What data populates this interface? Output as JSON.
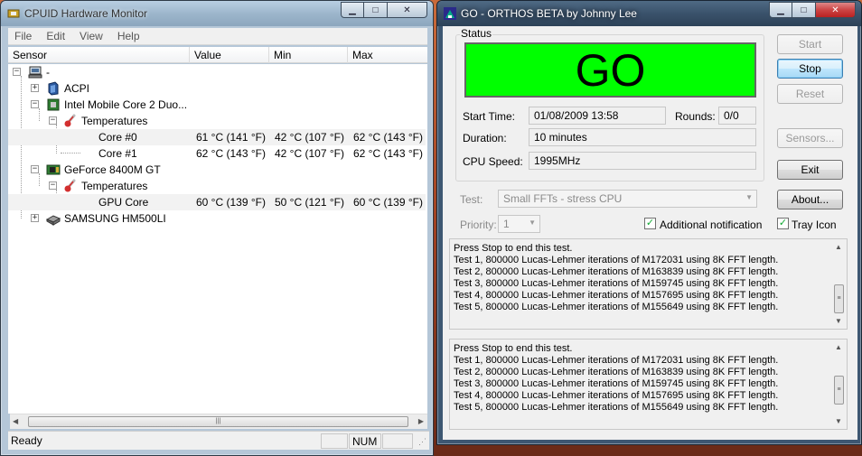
{
  "hwmon": {
    "title": "CPUID Hardware Monitor",
    "menu": [
      "File",
      "Edit",
      "View",
      "Help"
    ],
    "columns": [
      "Sensor",
      "Value",
      "Min",
      "Max"
    ],
    "root_label": "-",
    "tree": {
      "acpi": "ACPI",
      "cpu": "Intel Mobile Core 2 Duo...",
      "cpu_temps": "Temperatures",
      "core0": {
        "name": "Core #0",
        "value": "61 °C  (141 °F)",
        "min": "42 °C  (107 °F)",
        "max": "62 °C  (143 °F)"
      },
      "core1": {
        "name": "Core #1",
        "value": "62 °C  (143 °F)",
        "min": "42 °C  (107 °F)",
        "max": "62 °C  (143 °F)"
      },
      "gpu": "GeForce 8400M GT",
      "gpu_temps": "Temperatures",
      "gpucore": {
        "name": "GPU Core",
        "value": "60 °C  (139 °F)",
        "min": "50 °C  (121 °F)",
        "max": "60 °C  (139 °F)"
      },
      "hdd": "SAMSUNG HM500LI"
    },
    "status": "Ready",
    "num": "NUM"
  },
  "orthos": {
    "title": "GO - ORTHOS BETA by Johnny Lee",
    "status_group": "Status",
    "go_text": "GO",
    "go_color": "#00ff00",
    "labels": {
      "start_time": "Start Time:",
      "rounds": "Rounds:",
      "duration": "Duration:",
      "cpu_speed": "CPU Speed:",
      "test": "Test:",
      "priority": "Priority:"
    },
    "values": {
      "start_time": "01/08/2009 13:58",
      "rounds": "0/0",
      "duration": "10 minutes",
      "cpu_speed": "1995MHz",
      "test": "Small FFTs - stress CPU",
      "priority": "1"
    },
    "buttons": {
      "start": "Start",
      "stop": "Stop",
      "reset": "Reset",
      "sensors": "Sensors...",
      "exit": "Exit",
      "about": "About..."
    },
    "checks": {
      "additional_notification": "Additional notification",
      "tray_icon": "Tray Icon"
    },
    "log1": "Press Stop to end this test.\nTest 1, 800000 Lucas-Lehmer iterations of M172031 using 8K FFT length.\nTest 2, 800000 Lucas-Lehmer iterations of M163839 using 8K FFT length.\nTest 3, 800000 Lucas-Lehmer iterations of M159745 using 8K FFT length.\nTest 4, 800000 Lucas-Lehmer iterations of M157695 using 8K FFT length.\nTest 5, 800000 Lucas-Lehmer iterations of M155649 using 8K FFT length.",
    "log2": "Press Stop to end this test.\nTest 1, 800000 Lucas-Lehmer iterations of M172031 using 8K FFT length.\nTest 2, 800000 Lucas-Lehmer iterations of M163839 using 8K FFT length.\nTest 3, 800000 Lucas-Lehmer iterations of M159745 using 8K FFT length.\nTest 4, 800000 Lucas-Lehmer iterations of M157695 using 8K FFT length.\nTest 5, 800000 Lucas-Lehmer iterations of M155649 using 8K FFT length."
  }
}
